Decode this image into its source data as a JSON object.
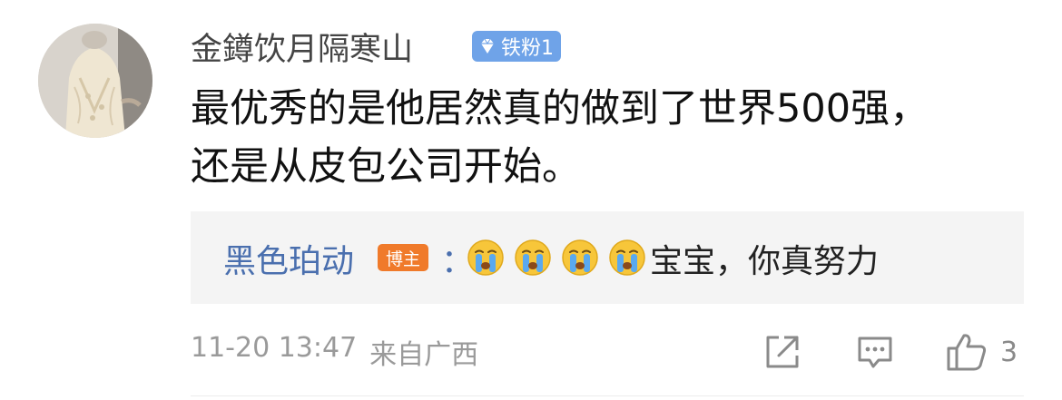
{
  "comment": {
    "author": "金鐏饮月隔寒山",
    "fan_badge": "铁粉1",
    "text_lines": [
      "最优秀的是他居然真的做到了世界500强，",
      "还是从皮包公司开始。"
    ],
    "date": "11-20 13:47",
    "location": "来自广西",
    "like_count": "3",
    "reply": {
      "author": "黑色珀动",
      "author_badge": "博主",
      "colon": "：",
      "emoji_count": 4,
      "emoji_icon": "crying-face-icon",
      "text": "宝宝，你真努力"
    }
  },
  "colors": {
    "reply_author": "#4a6fae",
    "fan_badge": "#6fa3e8",
    "author_badge": "#f07a2a",
    "meta_text": "#9a9a9a",
    "reply_background": "#f4f4f4"
  }
}
